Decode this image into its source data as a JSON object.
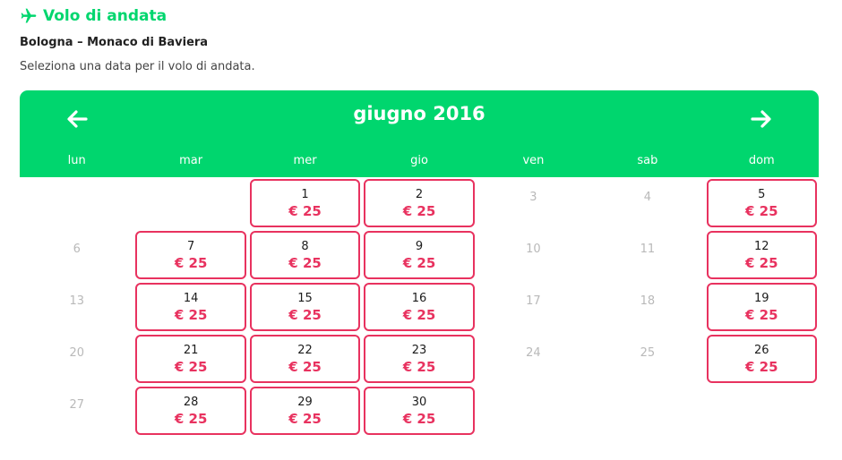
{
  "header": {
    "title": "Volo di andata",
    "route": "Bologna – Monaco di Baviera",
    "instruction": "Seleziona una data per il volo di andata."
  },
  "calendar": {
    "month_label": "giugno 2016",
    "weekdays": [
      "lun",
      "mar",
      "mer",
      "gio",
      "ven",
      "sab",
      "dom"
    ],
    "price_label": "€ 25",
    "days": {
      "d1": "1",
      "d2": "2",
      "d3": "3",
      "d4": "4",
      "d5": "5",
      "d6": "6",
      "d7": "7",
      "d8": "8",
      "d9": "9",
      "d10": "10",
      "d11": "11",
      "d12": "12",
      "d13": "13",
      "d14": "14",
      "d15": "15",
      "d16": "16",
      "d17": "17",
      "d18": "18",
      "d19": "19",
      "d20": "20",
      "d21": "21",
      "d22": "22",
      "d23": "23",
      "d24": "24",
      "d25": "25",
      "d26": "26",
      "d27": "27",
      "d28": "28",
      "d29": "29",
      "d30": "30"
    }
  },
  "icons": {
    "title_icon": "airplane-icon",
    "prev": "arrow-left-icon",
    "next": "arrow-right-icon"
  },
  "colors": {
    "accent_green": "#00d66e",
    "price_red": "#e8325f",
    "disabled_grey": "#b9b9b9"
  }
}
